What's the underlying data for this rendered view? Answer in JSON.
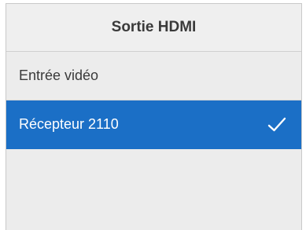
{
  "header": {
    "title": "Sortie HDMI"
  },
  "options": [
    {
      "label": "Entrée vidéo",
      "selected": false
    },
    {
      "label": "Récepteur 2110",
      "selected": true
    }
  ],
  "colors": {
    "selection": "#1b6fc6",
    "panel_background": "#ececec"
  },
  "icons": {
    "selected_marker": "checkmark-icon"
  }
}
